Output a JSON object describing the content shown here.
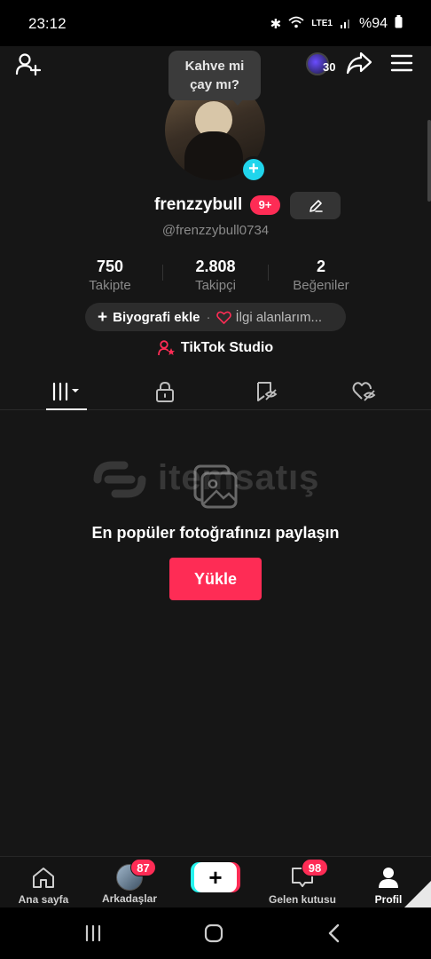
{
  "status_bar": {
    "time": "23:12",
    "battery": "%94",
    "network": "LTE1"
  },
  "top_bar": {
    "coin_count": "30"
  },
  "tooltip": {
    "text_line1": "Kahve mi",
    "text_line2": "çay mı?"
  },
  "profile": {
    "display_name": "frenzzybull",
    "notification_badge": "9+",
    "handle": "@frenzzybull0734"
  },
  "stats": [
    {
      "value": "750",
      "label": "Takipte"
    },
    {
      "value": "2.808",
      "label": "Takipçi"
    },
    {
      "value": "2",
      "label": "Beğeniler"
    }
  ],
  "bio": {
    "add_label": "Biyografi ekle",
    "separator": "·",
    "interests_label": "İlgi alanlarım..."
  },
  "studio_label": "TikTok Studio",
  "watermark_text": "itemsatış",
  "empty_state": {
    "title": "En popüler fotoğrafınızı paylaşın",
    "upload_label": "Yükle"
  },
  "bottom_nav": {
    "home": "Ana sayfa",
    "friends": "Arkadaşlar",
    "friends_badge": "87",
    "create": "+",
    "inbox": "Gelen kutusu",
    "inbox_badge": "98",
    "profile": "Profil"
  },
  "colors": {
    "accent": "#fe2c55",
    "cyan": "#20d5ec",
    "background": "#161616"
  }
}
